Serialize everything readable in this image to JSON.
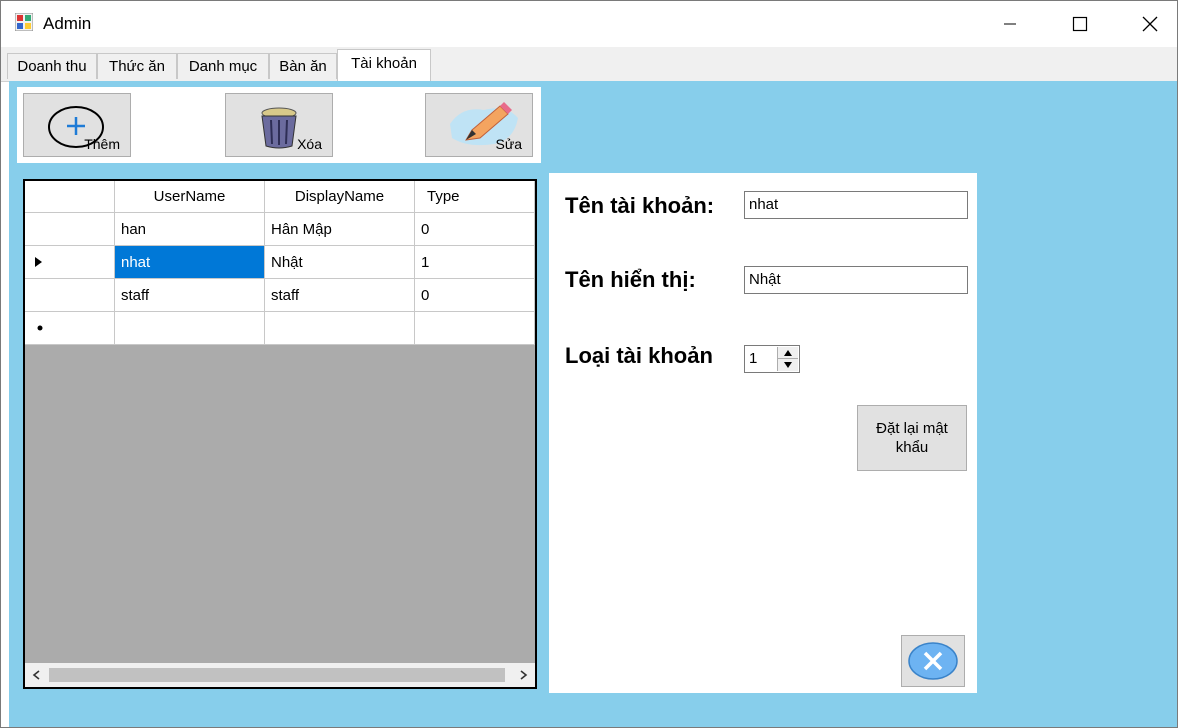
{
  "window": {
    "title": "Admin"
  },
  "tabs": [
    {
      "label": "Doanh thu"
    },
    {
      "label": "Thức ăn"
    },
    {
      "label": "Danh mục"
    },
    {
      "label": "Bàn ăn"
    },
    {
      "label": "Tài khoản",
      "active": true
    }
  ],
  "toolbar": {
    "add_label": "Thêm",
    "delete_label": "Xóa",
    "edit_label": "Sửa"
  },
  "grid": {
    "columns": [
      "UserName",
      "DisplayName",
      "Type"
    ],
    "rows": [
      {
        "username": "han",
        "displayname": "Hân Mập",
        "type": "0"
      },
      {
        "username": "nhat",
        "displayname": "Nhật",
        "type": "1",
        "selected": true
      },
      {
        "username": "staff",
        "displayname": "staff",
        "type": "0"
      }
    ]
  },
  "detail": {
    "account_label": "Tên tài khoản:",
    "account_value": "nhat",
    "display_label": "Tên hiển thị:",
    "display_value": "Nhật",
    "type_label": "Loại tài khoản",
    "type_value": "1",
    "reset_button": "Đặt lại mật khẩu"
  },
  "colors": {
    "content_bg": "#87ceeb",
    "selection": "#0078d7"
  }
}
